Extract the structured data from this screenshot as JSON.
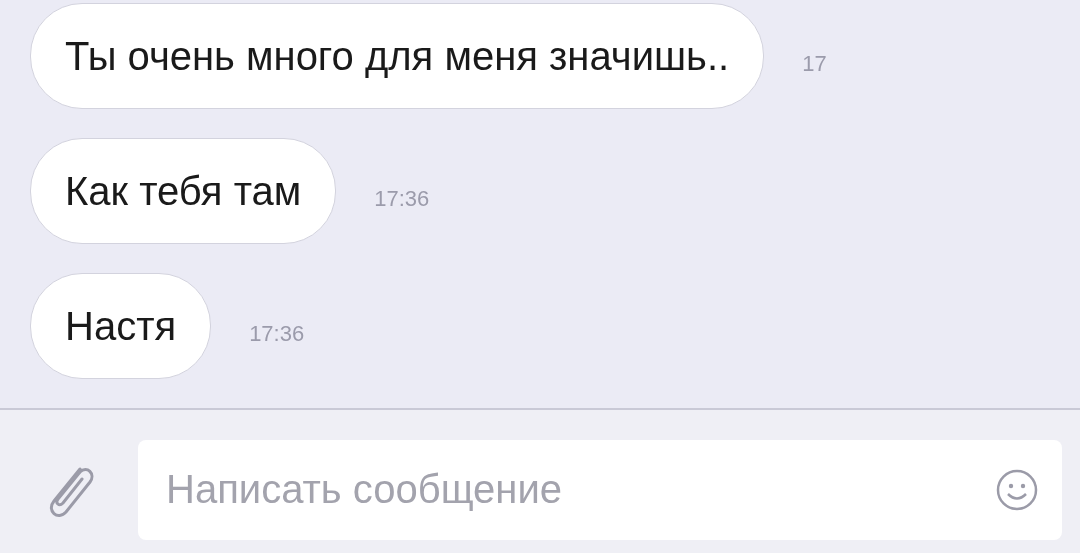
{
  "messages": [
    {
      "text": "Ты очень много для меня значишь..",
      "time": "17"
    },
    {
      "text": "Как тебя там",
      "time": "17:36"
    },
    {
      "text": "Настя",
      "time": "17:36"
    }
  ],
  "composer": {
    "placeholder": "Написать сообщение"
  }
}
